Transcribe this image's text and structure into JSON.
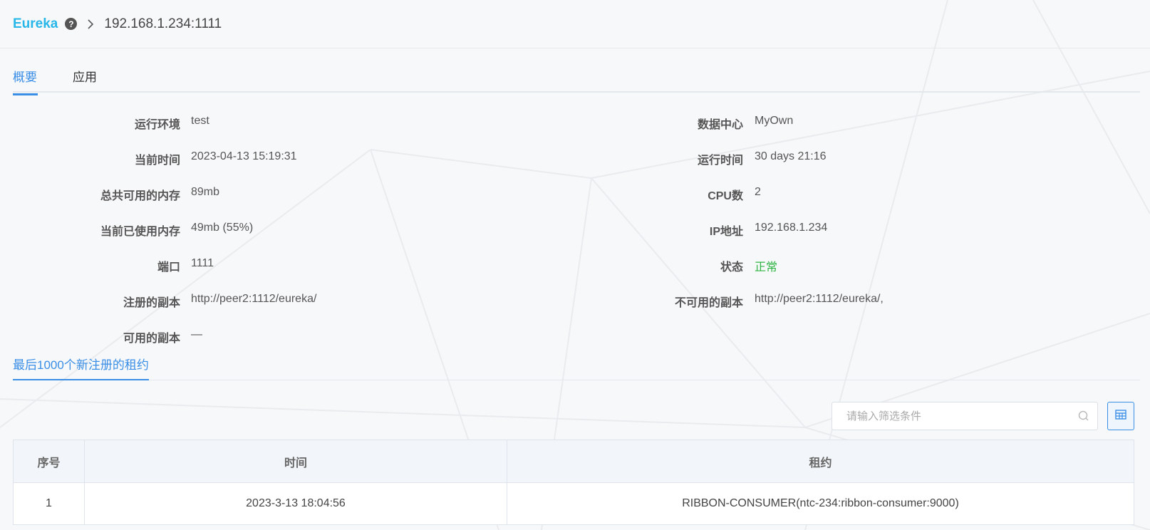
{
  "header": {
    "brand": "Eureka",
    "help_icon": "question-circle-icon",
    "separator_icon": "chevron-right-icon",
    "current": "192.168.1.234:1111"
  },
  "tabs": [
    {
      "label": "概要",
      "active": true
    },
    {
      "label": "应用",
      "active": false
    }
  ],
  "info": {
    "left": [
      {
        "label": "运行环境",
        "value": "test"
      },
      {
        "label": "当前时间",
        "value": "2023-04-13 15:19:31"
      },
      {
        "label": "总共可用的内存",
        "value": "89mb"
      },
      {
        "label": "当前已使用内存",
        "value": "49mb (55%)"
      },
      {
        "label": "端口",
        "value": "1111"
      },
      {
        "label": "注册的副本",
        "value": "http://peer2:1112/eureka/"
      },
      {
        "label": "可用的副本",
        "value": "—"
      }
    ],
    "right": [
      {
        "label": "数据中心",
        "value": "MyOwn"
      },
      {
        "label": "运行时间",
        "value": "30 days 21:16"
      },
      {
        "label": "CPU数",
        "value": "2"
      },
      {
        "label": "IP地址",
        "value": "192.168.1.234"
      },
      {
        "label": "状态",
        "value": "正常"
      },
      {
        "label": "不可用的副本",
        "value": "http://peer2:1112/eureka/,"
      }
    ]
  },
  "section": {
    "title": "最后1000个新注册的租约"
  },
  "filter": {
    "placeholder": "请输入筛选条件",
    "value": "",
    "icon": "search-icon"
  },
  "grid_button": {
    "icon": "table-grid-icon"
  },
  "colors": {
    "accent": "#3a8ee6",
    "brand": "#29b6e8",
    "status_ok": "#2fb344"
  },
  "table": {
    "columns": [
      "序号",
      "时间",
      "租约"
    ],
    "rows": [
      [
        "1",
        "2023-3-13 18:04:56",
        "RIBBON-CONSUMER(ntc-234:ribbon-consumer:9000)"
      ]
    ]
  }
}
